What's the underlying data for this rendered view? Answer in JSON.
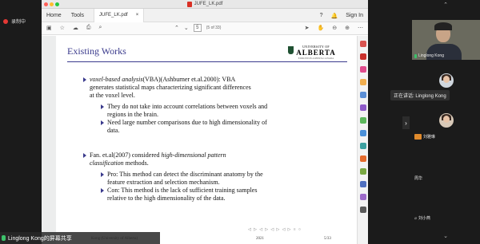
{
  "recording": {
    "label": "录制中"
  },
  "window": {
    "title": "JUFE_LK.pdf"
  },
  "tabs": {
    "home": "Home",
    "tools": "Tools",
    "doc": "JUFE_LK.pdf",
    "doc_close": "×",
    "sign_in": "Sign In"
  },
  "toolbar": {
    "save_icon": "save-icon",
    "star_icon": "star-icon",
    "upload_icon": "cloud-upload-icon",
    "print_icon": "print-icon",
    "search_icon": "search-icon",
    "page_up": "⌃",
    "page_down": "⌄",
    "page_current": "5",
    "page_total": "(5 of 33)"
  },
  "slide": {
    "title": "Existing Works",
    "logo": {
      "l1": "UNIVERSITY OF",
      "l2": "ALBERTA",
      "l3": "EDMONTON ALBERTA CANADA"
    },
    "bullet1": {
      "line1_em": "voxel-based analysis",
      "line1_rest": "(VBA)(Ashburner et.al.2000): VBA",
      "line2": "generates statistical maps characterizing significant differences",
      "line3": "at the voxel level.",
      "sub1_l1": "They do not take into account correlations between voxels and",
      "sub1_l2": "regions in the brain.",
      "sub2_l1": "Need large number comparisons due to high dimensionality of",
      "sub2_l2": "data."
    },
    "bullet2": {
      "line1_pre": "Fan. et.al(2007) considered ",
      "line1_em": "high-dimensional pattern",
      "line2_em": "classification",
      "line2_rest": " methods.",
      "sub1_l1": "Pro: This method can detect the discriminant anatomy by the",
      "sub1_l2": "feature extraction and selection mechanism.",
      "sub2_l1": "Con: This method is the lack of sufficient training samples",
      "sub2_l2": "relative to the high dimensionality of the data."
    },
    "footer": {
      "left": "Kong (University of Alberta)",
      "mid": "2021",
      "right": "5/33",
      "nav": "◁ ▷ ◁ ▷ ◁ ▷ ◁ ▷ ≡ ○"
    }
  },
  "share": {
    "label": "Linglong Kong的屏幕共享"
  },
  "speaking": {
    "label": "正在讲话: Linglong Kong"
  },
  "participants": [
    {
      "name": "Linglong Kong"
    },
    {
      "name": ""
    },
    {
      "name": "刘雅琳"
    },
    {
      "name": "周华"
    },
    {
      "name": "刘小燕"
    }
  ]
}
